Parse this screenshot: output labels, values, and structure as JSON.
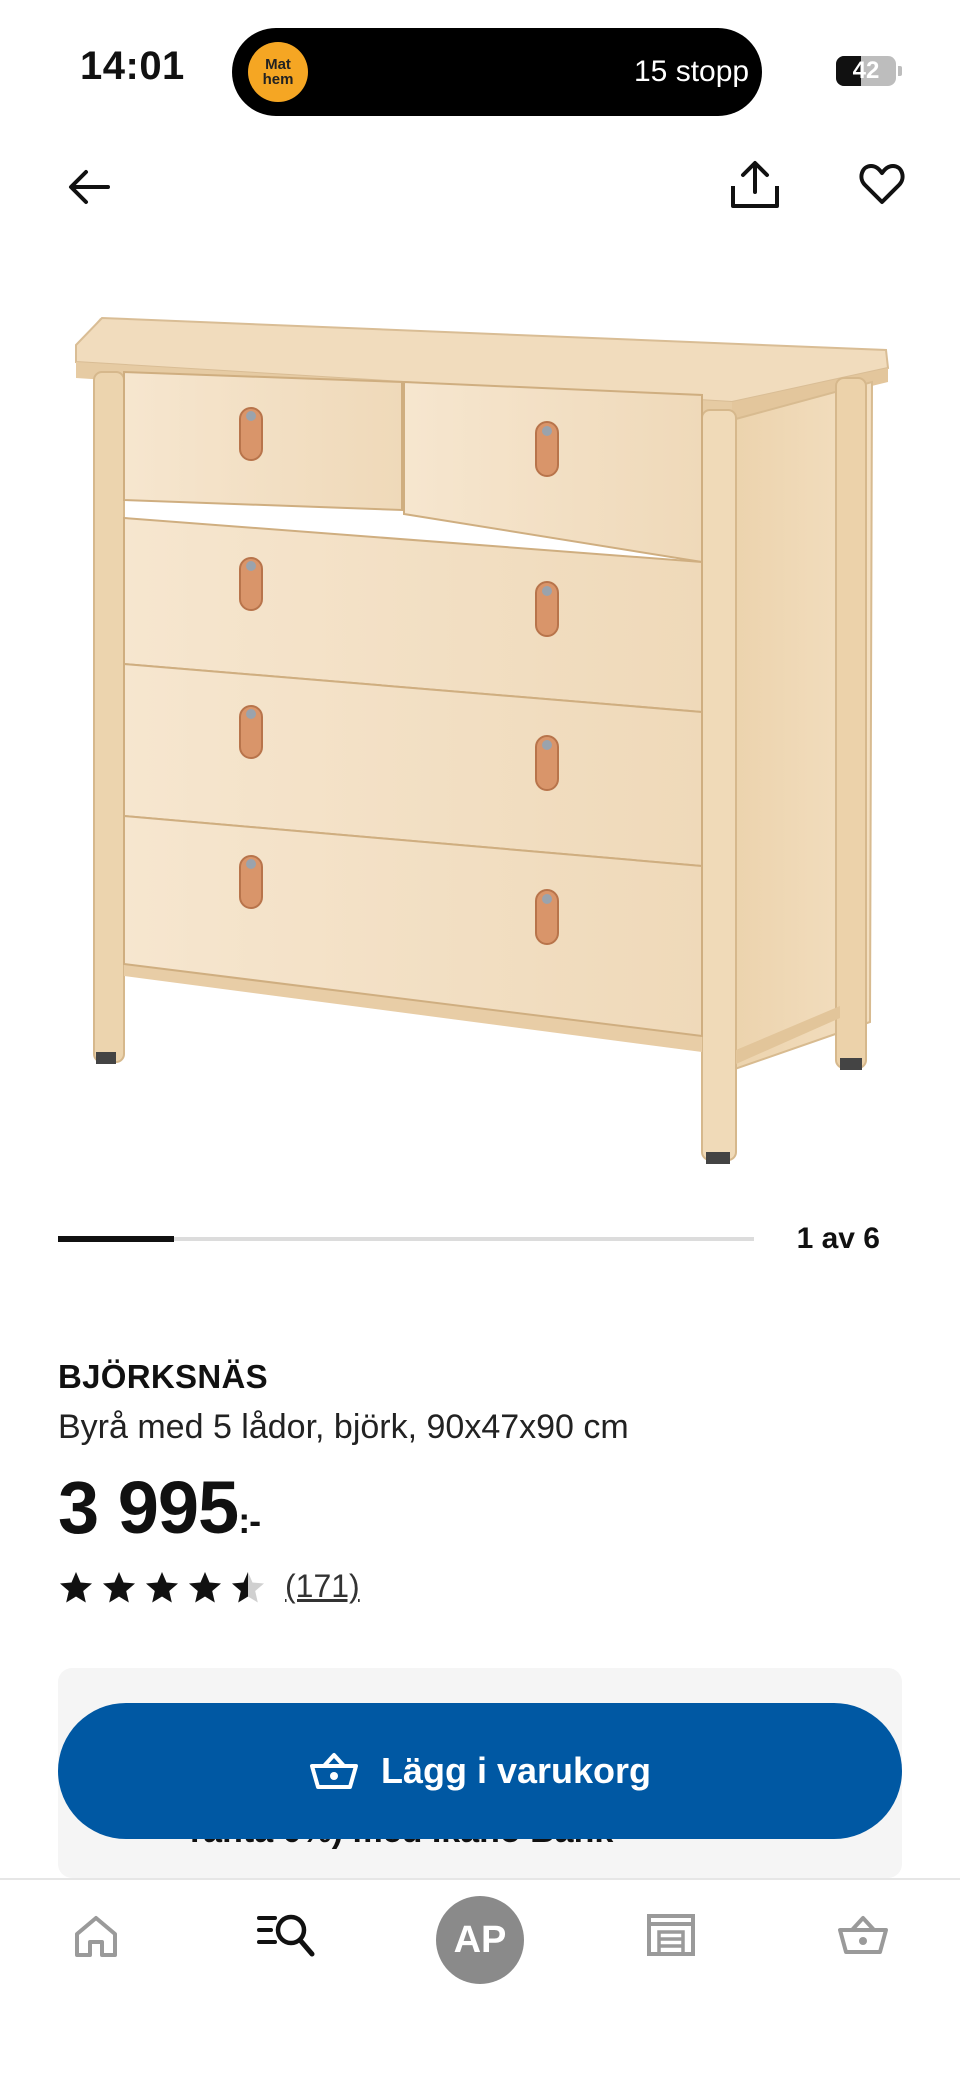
{
  "status_bar": {
    "time": "14:01",
    "activity_logo_line1": "Mat",
    "activity_logo_line2": "hem",
    "activity_text": "15 stopp",
    "battery": "42",
    "battery_level": 0.42
  },
  "header": {
    "back_icon": "arrow-left-icon",
    "share_icon": "share-icon",
    "favorite_icon": "heart-icon"
  },
  "gallery": {
    "count_label": "1 av 6",
    "current": 1,
    "total": 6
  },
  "product": {
    "name": "BJÖRKSNÄS",
    "description": "Byrå med 5 lådor, björk, 90x47x90 cm",
    "price": "3 995",
    "price_suffix": ":-",
    "rating": 4.5,
    "review_count": "(171)"
  },
  "financing": {
    "partial_text": "ränta 0%) med Ikano Bank"
  },
  "cta": {
    "label": "Lägg i varukorg",
    "icon": "basket-icon",
    "color": "#0058a3"
  },
  "bottom_nav": {
    "home_icon": "home-icon",
    "search_icon": "search-list-icon",
    "avatar_initials": "AP",
    "store_icon": "store-icon",
    "basket_icon": "basket-icon"
  }
}
